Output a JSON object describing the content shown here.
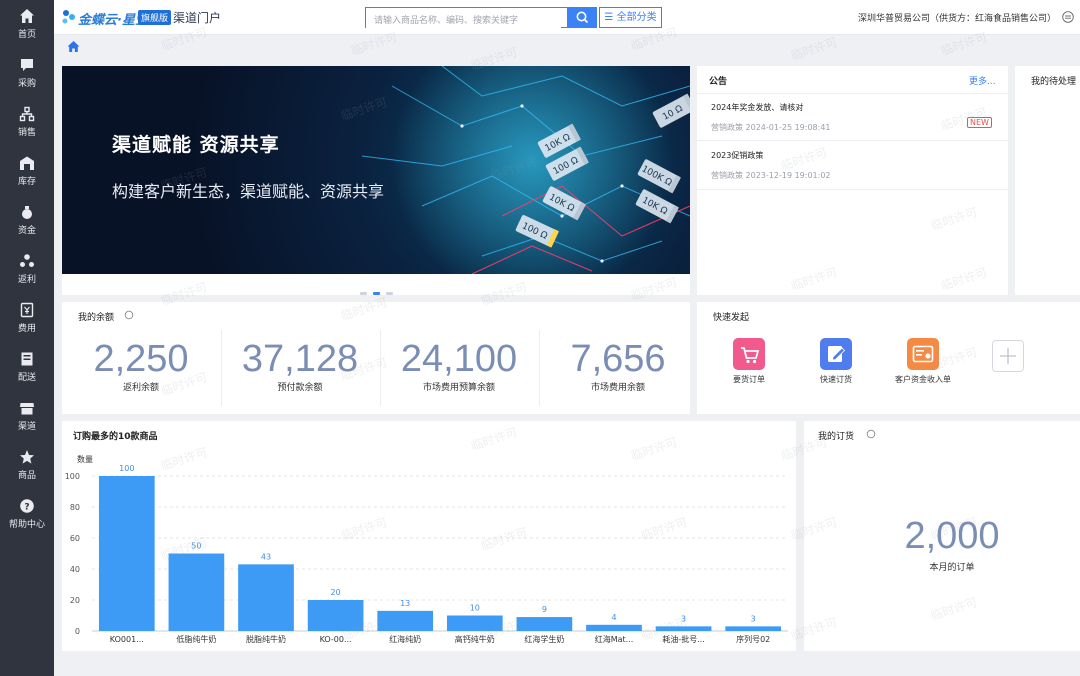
{
  "sidebar": {
    "items": [
      {
        "label": "首页",
        "icon": "home-icon"
      },
      {
        "label": "采购",
        "icon": "chat-icon"
      },
      {
        "label": "销售",
        "icon": "network-icon"
      },
      {
        "label": "库存",
        "icon": "warehouse-icon"
      },
      {
        "label": "资金",
        "icon": "money-bag-icon"
      },
      {
        "label": "返利",
        "icon": "people-icon"
      },
      {
        "label": "费用",
        "icon": "expense-icon"
      },
      {
        "label": "配送",
        "icon": "delivery-icon"
      },
      {
        "label": "渠道",
        "icon": "store-icon"
      },
      {
        "label": "商品",
        "icon": "star-icon"
      },
      {
        "label": "帮助中心",
        "icon": "help-icon"
      }
    ]
  },
  "header": {
    "brand": "金蝶云·星空",
    "edition": "旗舰版",
    "portal": "渠道门户",
    "search_placeholder": "请输入商品名称、编码、搜索关键字",
    "category_label": "☰ 全部分类",
    "company": "深圳华普贸易公司（供货方：红海食品销售公司）"
  },
  "banner": {
    "title": "渠道赋能 资源共享",
    "subtitle": "构建客户新生态，渠道赋能、资源共享",
    "slides": 3,
    "active_slide": 2,
    "chip_texts": [
      "10K Ω",
      "100 Ω",
      "10K Ω",
      "100K Ω",
      "100 Ω",
      "10K Ω",
      "10 Ω"
    ]
  },
  "notice": {
    "title": "公告",
    "more": "更多...",
    "items": [
      {
        "title": "2024年奖金发放、请核对",
        "meta": "营销政策 2024-01-25 19:08:41",
        "badge": "NEW"
      },
      {
        "title": "2023促销政策",
        "meta": "营销政策 2023-12-19 19:01:02",
        "badge": ""
      }
    ]
  },
  "pending": {
    "title": "我的待处理"
  },
  "balance": {
    "title": "我的余额",
    "items": [
      {
        "value": "2,250",
        "label": "返利余额"
      },
      {
        "value": "37,128",
        "label": "预付款余额"
      },
      {
        "value": "24,100",
        "label": "市场费用预算余额"
      },
      {
        "value": "7,656",
        "label": "市场费用余额"
      }
    ]
  },
  "quick": {
    "title": "快速发起",
    "items": [
      {
        "label": "要货订单",
        "icon": "cart-icon",
        "color": "#f25a8d"
      },
      {
        "label": "快速订货",
        "icon": "edit-icon",
        "color": "#4f7df0"
      },
      {
        "label": "客户资金收入单",
        "icon": "receipt-icon",
        "color": "#f58a45"
      }
    ]
  },
  "top10": {
    "title": "订购最多的10款商品"
  },
  "orders": {
    "title": "我的订货",
    "value": "2,000",
    "label": "本月的订单"
  },
  "watermark_text": "临时许可",
  "chart_data": {
    "type": "bar",
    "title": "订购最多的10款商品",
    "ylabel": "数量",
    "xlabel": "",
    "categories": [
      "KO001...",
      "低脂纯牛奶",
      "脱脂纯牛奶",
      "KO-00...",
      "红海纯奶",
      "高钙纯牛奶",
      "红海学生奶",
      "红海Mat...",
      "耗油-批号...",
      "序列号02"
    ],
    "values": [
      100,
      50,
      43,
      20,
      13,
      10,
      9,
      4,
      3,
      3
    ],
    "ylim": [
      0,
      100
    ],
    "yticks": [
      0,
      20,
      40,
      60,
      80,
      100
    ],
    "grid": true,
    "color": "#3d9bf5"
  }
}
